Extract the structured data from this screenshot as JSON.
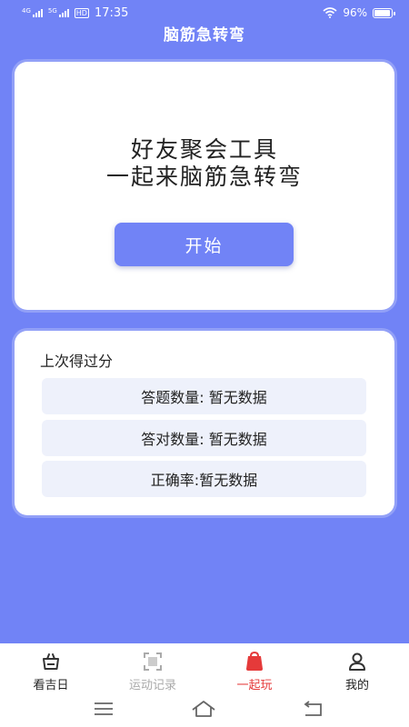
{
  "status_bar": {
    "network_1": "4G",
    "network_2": "5G",
    "hd_badge": "HD",
    "time": "17:35",
    "battery_text": "96%",
    "battery_level": 0.96
  },
  "header": {
    "title": "脑筋急转弯"
  },
  "hero": {
    "line1": "好友聚会工具",
    "line2": "一起来脑筋急转弯",
    "start_label": "开始"
  },
  "score": {
    "title": "上次得过分",
    "rows": [
      "答题数量: 暂无数据",
      "答对数量: 暂无数据",
      "正确率:暂无数据"
    ]
  },
  "tabs": [
    {
      "label": "看吉日",
      "icon": "basket-icon",
      "state": "normal"
    },
    {
      "label": "运动记录",
      "icon": "scan-frame-icon",
      "state": "disabled"
    },
    {
      "label": "一起玩",
      "icon": "play-bag-icon",
      "state": "active"
    },
    {
      "label": "我的",
      "icon": "person-icon",
      "state": "normal"
    }
  ],
  "colors": {
    "background": "#7183f6",
    "primary_button": "#7183f6",
    "active_tab": "#e53a3a",
    "disabled_tab": "#aaaaaa",
    "row_background": "#eef1fb"
  },
  "nav_icons": [
    "menu-icon",
    "home-icon",
    "back-icon"
  ]
}
